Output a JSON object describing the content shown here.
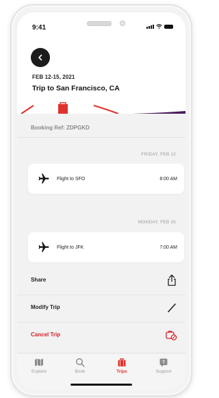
{
  "status_bar": {
    "time": "9:41"
  },
  "header": {
    "date_range": "FEB 12-15, 2021",
    "trip_title": "Trip to San Francisco, CA",
    "back_icon": "chevron-left-icon"
  },
  "booking": {
    "reference": "Booking Ref: ZDPGKD"
  },
  "itinerary": [
    {
      "day": "FRIDAY, FEB 12",
      "flight": "Flight to SFO",
      "time": "8:00 AM",
      "icon": "plane-icon"
    },
    {
      "day": "MONDAY, FEB 15",
      "flight": "Flight to JFK",
      "time": "7:00 AM",
      "icon": "plane-icon"
    }
  ],
  "actions": [
    {
      "label": "Share",
      "icon": "share-icon"
    },
    {
      "label": "Modify Trip",
      "icon": "pencil-icon"
    },
    {
      "label": "Cancel Trip",
      "icon": "cancel-trip-icon"
    }
  ],
  "tabs": [
    {
      "label": "Explore",
      "icon": "map-icon",
      "active": false
    },
    {
      "label": "Book",
      "icon": "search-icon",
      "active": false
    },
    {
      "label": "Trips",
      "icon": "suitcase-icon",
      "active": true
    },
    {
      "label": "Support",
      "icon": "help-icon",
      "active": false
    }
  ],
  "colors": {
    "accent": "#e0322c",
    "danger": "#d11f26",
    "purple": "#4a1d5c",
    "background": "#f2f2f2"
  }
}
